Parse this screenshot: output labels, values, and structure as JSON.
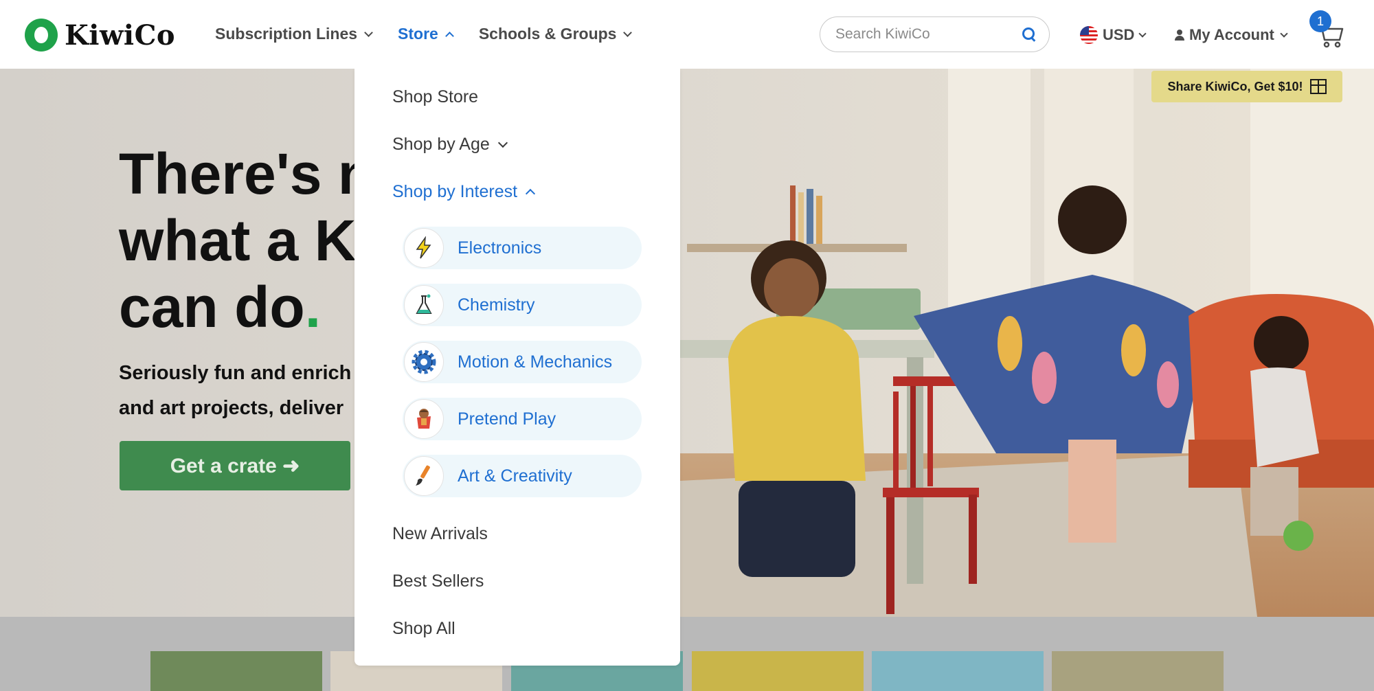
{
  "brand": {
    "name": "KiwiCo"
  },
  "nav": {
    "items": [
      {
        "label": "Subscription Lines",
        "expanded": false
      },
      {
        "label": "Store",
        "expanded": true
      },
      {
        "label": "Schools & Groups",
        "expanded": false
      }
    ]
  },
  "search": {
    "placeholder": "Search KiwiCo",
    "value": ""
  },
  "currency": {
    "label": "USD"
  },
  "account": {
    "label": "My Account"
  },
  "cart": {
    "count": "1"
  },
  "share_banner": {
    "label": "Share KiwiCo, Get $10!"
  },
  "hero": {
    "title_lines": [
      "There's no",
      "what a Ki",
      "can do"
    ],
    "title_dot": ".",
    "subtitle_lines": [
      "Seriously fun and enrich",
      "and art projects, deliver"
    ],
    "cta_label": "Get a crate ➜"
  },
  "store_menu": {
    "items": [
      {
        "label": "Shop Store"
      },
      {
        "label": "Shop by Age",
        "expandable": true,
        "expanded": false
      },
      {
        "label": "Shop by Interest",
        "expandable": true,
        "expanded": true
      }
    ],
    "interests": [
      {
        "label": "Electronics",
        "icon": "lightning-bolt-icon"
      },
      {
        "label": "Chemistry",
        "icon": "flask-icon"
      },
      {
        "label": "Motion & Mechanics",
        "icon": "gear-icon"
      },
      {
        "label": "Pretend Play",
        "icon": "superhero-kid-icon"
      },
      {
        "label": "Art & Creativity",
        "icon": "paintbrush-icon"
      }
    ],
    "footer_items": [
      {
        "label": "New Arrivals"
      },
      {
        "label": "Best Sellers"
      },
      {
        "label": "Shop All"
      }
    ]
  },
  "colors": {
    "accent": "#1f6fd1",
    "brand_green": "#1fa24a",
    "cta": "#3f8b4e",
    "share_banner": "#e4d98a",
    "pill_bg": "#eef7fb"
  }
}
